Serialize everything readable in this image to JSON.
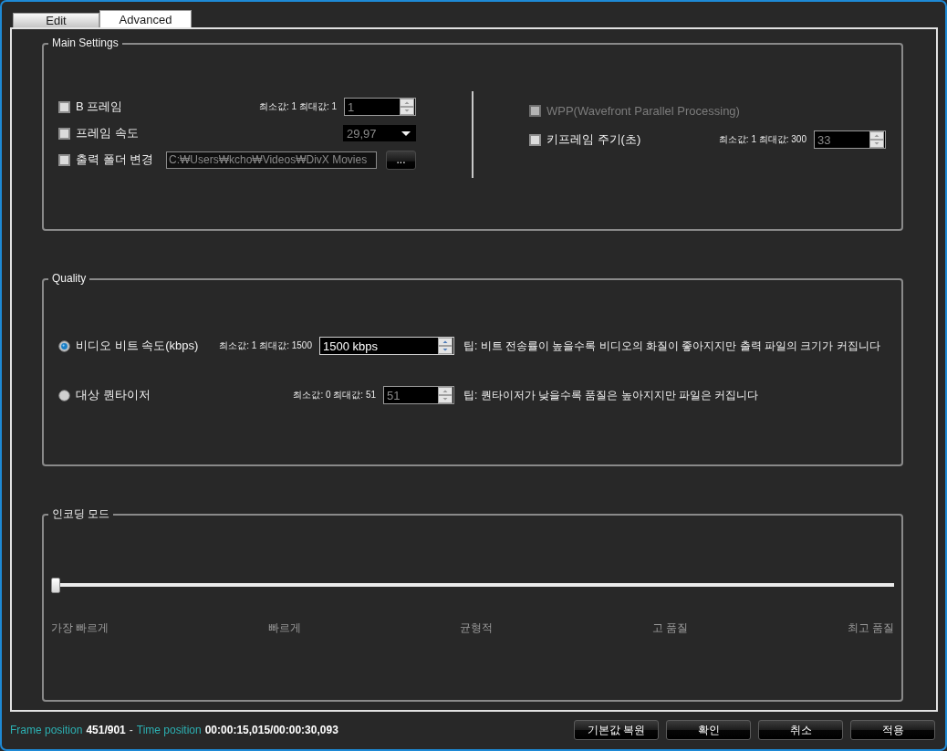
{
  "tabs": [
    {
      "label": "Edit",
      "selected": false
    },
    {
      "label": "Advanced",
      "selected": true
    }
  ],
  "main_settings": {
    "title": "Main Settings",
    "left_rows": [
      {
        "kind": "spin",
        "label": "B 프레임",
        "checked": false,
        "disabled": false,
        "range": "최소값: 1 최대값: 1",
        "value": "1",
        "field_disabled": true
      },
      {
        "kind": "dropdown",
        "label": "프레임 속도",
        "checked": false,
        "disabled": false,
        "value": "29,97",
        "field_disabled": true
      },
      {
        "kind": "folder",
        "label": "출력 폴더 변경",
        "checked": false,
        "disabled": false,
        "value": "C:₩Users₩kcho₩Videos₩DivX Movies",
        "field_disabled": true,
        "button": "..."
      }
    ],
    "right_rows": [
      {
        "kind": "plain",
        "label": "WPP(Wavefront Parallel Processing)",
        "checked": false,
        "disabled": true
      },
      {
        "kind": "spin",
        "label": "키프레임 주기(초)",
        "checked": false,
        "disabled": false,
        "range": "최소값: 1 최대값: 300",
        "value": "33",
        "field_disabled": true
      }
    ]
  },
  "quality": {
    "title": "Quality",
    "options": [
      {
        "label": "비디오 비트 속도(kbps)",
        "selected": true,
        "range": "최소값: 1 최대값: 1500",
        "value": "1500 kbps",
        "field_disabled": false,
        "tip": "팁: 비트 전송률이 높을수록 비디오의 화질이 좋아지지만 출력 파일의 크기가 커집니다"
      },
      {
        "label": "대상 퀀타이저",
        "selected": false,
        "range": "최소값: 0 최대값: 51",
        "value": "51",
        "field_disabled": true,
        "tip": "팁: 퀀타이저가 낮을수록 품질은 높아지지만 파일은 커집니다"
      }
    ]
  },
  "encoding_mode": {
    "title": "인코딩 모드",
    "slider": {
      "level": 0
    },
    "labels": [
      "가장 빠르게",
      "빠르게",
      "균형적",
      "고 품질",
      "최고 품질"
    ]
  },
  "status_bar": {
    "frame_label": "Frame position",
    "frame_value": "451/901",
    "separator": "-",
    "time_label": "Time position",
    "time_value": "00:00:15,015/00:00:30,093"
  },
  "buttons": [
    "기본값 복원",
    "확인",
    "취소",
    "적용"
  ]
}
